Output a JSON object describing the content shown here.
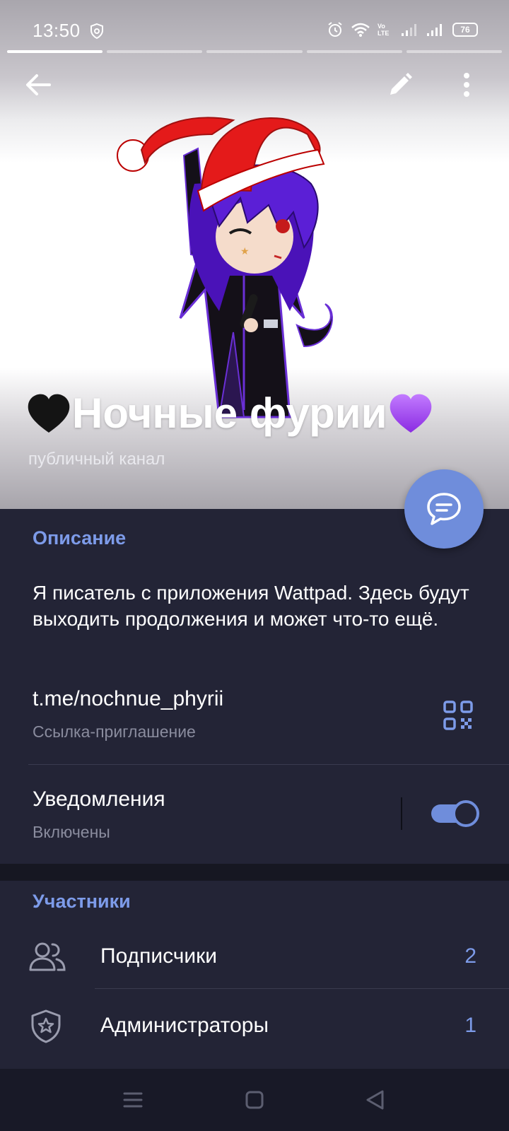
{
  "status_bar": {
    "time": "13:50",
    "battery": "76",
    "volte": "Vo LTE"
  },
  "channel": {
    "name": "Ночные фурии",
    "type_label": "публичный канал"
  },
  "info": {
    "description_label": "Описание",
    "description": "Я писатель с приложения Wattpad. Здесь будут выходить продолжения и может что-то ещё.",
    "link": "t.me/nochnue_phyrii",
    "link_caption": "Ссылка-приглашение",
    "notifications_label": "Уведомления",
    "notifications_status": "Включены",
    "notifications_on": true
  },
  "members": {
    "section_label": "Участники",
    "rows": [
      {
        "label": "Подписчики",
        "count": "2",
        "icon": "people-icon"
      },
      {
        "label": "Администраторы",
        "count": "1",
        "icon": "admin-shield-icon"
      }
    ]
  },
  "colors": {
    "accent": "#7d9be9",
    "fab": "#6f8ddb",
    "panel": "#232436",
    "separator": "#161722"
  },
  "icons": [
    "back-arrow-icon",
    "edit-pencil-icon",
    "more-vertical-icon",
    "chat-bubble-icon",
    "qr-code-icon",
    "black-heart-icon",
    "purple-heart-icon",
    "people-icon",
    "admin-shield-icon",
    "menu-icon",
    "home-icon",
    "back-triangle-icon"
  ]
}
